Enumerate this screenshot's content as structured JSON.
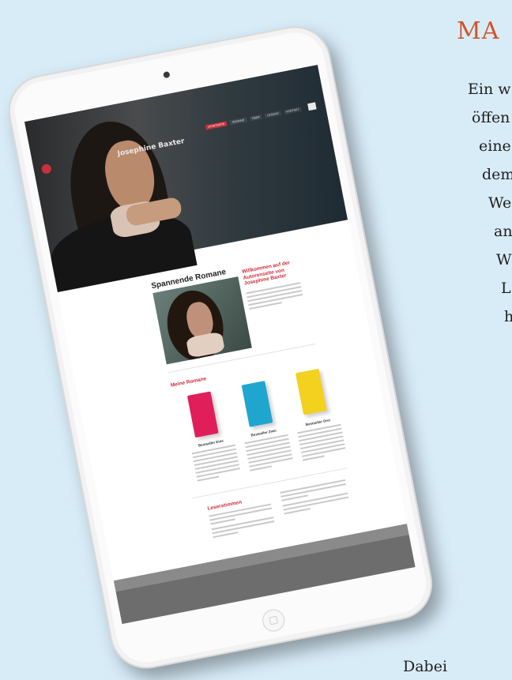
{
  "side_text": {
    "title": "MA",
    "lines": [
      "Ein w",
      "öffen",
      "eine",
      "dem",
      "We",
      "an",
      "W",
      "L",
      "h"
    ],
    "bottom": "Dabei"
  },
  "site": {
    "title": "Josephine Baxter",
    "nav": [
      "STARTSEITE",
      "ROMANE",
      "ÜBER",
      "LESUNG",
      "KONTAKT"
    ],
    "section_heading": "Spannende Romane",
    "welcome_heading": "Willkommen auf der Autorenseite von Josephine Baxter",
    "novels_heading": "Meine Romane",
    "books": [
      {
        "title": "Bestseller Eins",
        "color": "#e01f5a"
      },
      {
        "title": "Bestseller Zwei",
        "color": "#1ea6cf"
      },
      {
        "title": "Bestseller Drei",
        "color": "#f2d11f"
      }
    ],
    "reviews_heading": "Leserstimmen"
  },
  "colors": {
    "background": "#d8ecf8",
    "accent_red": "#d02d3b",
    "side_title": "#d0552a",
    "footer": "#6d6d6d"
  }
}
